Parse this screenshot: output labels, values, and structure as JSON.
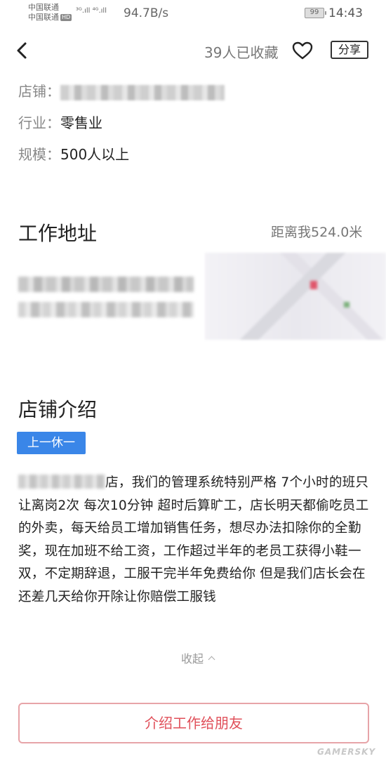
{
  "status_bar": {
    "carrier1": "中国联通",
    "carrier2": "中国联通",
    "hd": "HD",
    "net": "³ᴳ.ıll ⁴ᴳ.ıll",
    "speed": "94.7B/s",
    "battery": "99",
    "time": "14:43"
  },
  "header": {
    "favorites": "39人已收藏",
    "share_label": "分享"
  },
  "info": {
    "store_label": "店铺：",
    "industry_label": "行业：",
    "industry_value": "零售业",
    "scale_label": "规模：",
    "scale_value": "500人以上"
  },
  "address": {
    "title": "工作地址",
    "distance": "距离我524.0米"
  },
  "intro": {
    "title": "店铺介绍",
    "tag": "上一休一",
    "text": "店，我们的管理系统特别严格 7个小时的班只让离岗2次 每次10分钟 超时后算旷工，店长明天都偷吃员工的外卖，每天给员工增加销售任务，想尽办法扣除你的全勤奖，现在加班不给工资，工作超过半年的老员工获得小鞋一双，不定期辞退，工服干完半年免费给你 但是我们店长会在还差几天给你开除让你赔偿工服钱",
    "collapse": "收起"
  },
  "footer": {
    "button": "介绍工作给朋友",
    "watermark": "GAMERSKY"
  }
}
